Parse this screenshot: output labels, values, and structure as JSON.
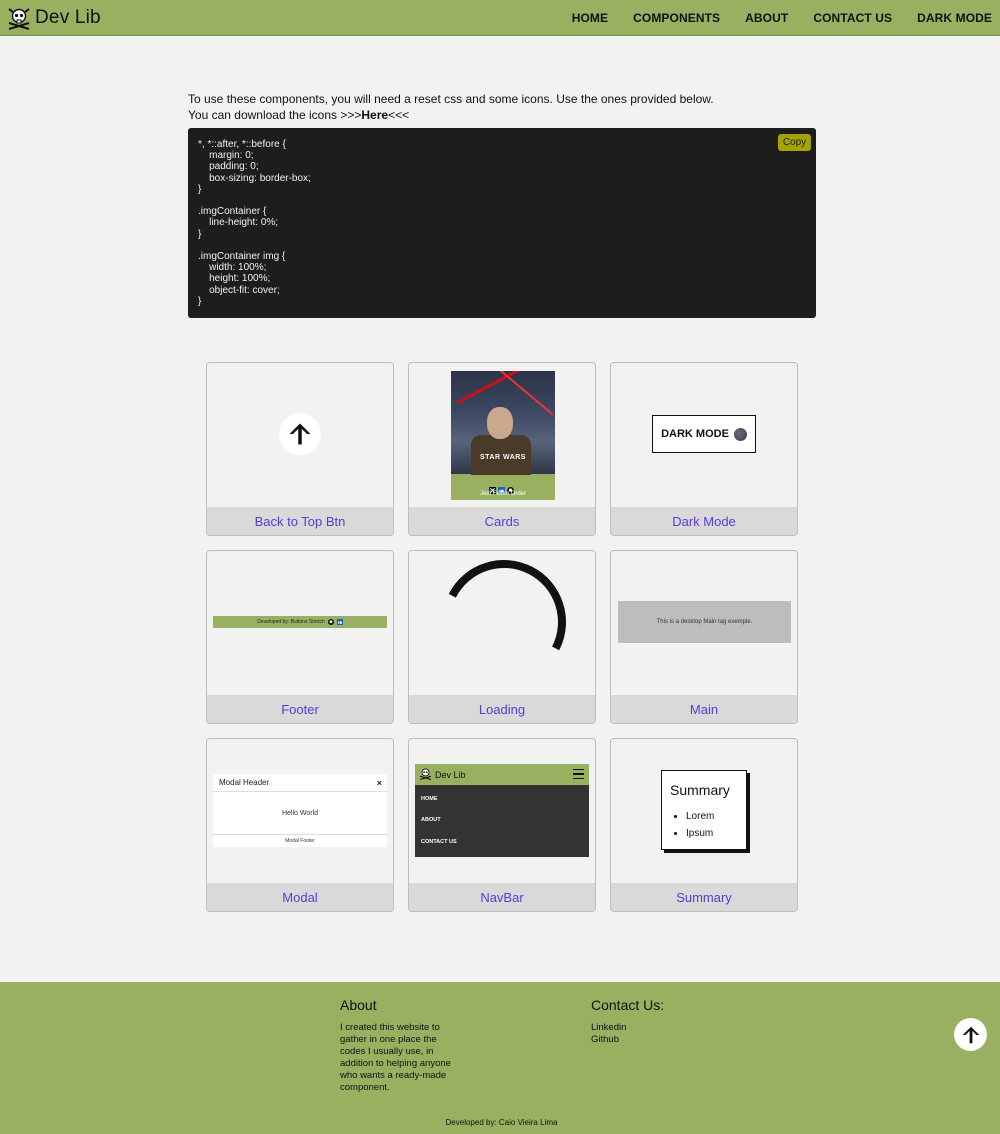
{
  "header": {
    "logo_text": "Dev Lib",
    "logo_icon": "skull-crossbones-icon",
    "nav": [
      "HOME",
      "COMPONENTS",
      "ABOUT",
      "CONTACT US",
      "DARK MODE"
    ]
  },
  "intro": {
    "line1": "To use these components, you will need a reset css and some icons. Use the ones provided below.",
    "line2_prefix": "You can download the icons  >>>",
    "line2_link": "Here",
    "line2_suffix": "<<<"
  },
  "code_block": {
    "copy_label": "Copy",
    "code": "*, *::after, *::before {\n    margin: 0;\n    padding: 0;\n    box-sizing: border-box;\n}\n\n.imgContainer {\n    line-height: 0%;\n}\n\n.imgContainer img {\n    width: 100%;\n    height: 100%;\n    object-fit: cover;\n}"
  },
  "components": {
    "back_to_top": {
      "label": "Back to Top Btn",
      "icon": "arrow-up-icon"
    },
    "cards": {
      "label": "Cards",
      "poster_text": "STAR WARS",
      "poster_title": "Jedi Fallen Order",
      "icons": [
        "x-icon",
        "linkedin-icon",
        "github-icon"
      ]
    },
    "dark_mode": {
      "label": "Dark Mode",
      "button_text": "DARK MODE",
      "icon": "moon-icon"
    },
    "footer": {
      "label": "Footer",
      "text": "Developed by: Buttons Stretch",
      "icons": [
        "github-icon",
        "linkedin-icon"
      ]
    },
    "loading": {
      "label": "Loading"
    },
    "main": {
      "label": "Main",
      "text": "This is a desktop Main tag exemple."
    },
    "modal": {
      "label": "Modal",
      "header": "Modal Header",
      "close": "×",
      "body": "Hello World",
      "footer": "Modal Footer"
    },
    "navbar": {
      "label": "NavBar",
      "title": "Dev Lib",
      "items": [
        "HOME",
        "ABOUT",
        "CONTACT US"
      ],
      "menu_icon": "hamburger-icon"
    },
    "summary": {
      "label": "Summary",
      "title": "Summary",
      "items": [
        "Lorem",
        "Ipsum"
      ]
    }
  },
  "footer": {
    "about_title": "About",
    "about_text": "I created this website to gather in one place the codes I usually use, in addition to helping anyone who wants a ready-made component.",
    "contact_title": "Contact Us:",
    "links": [
      "Linkedin",
      "Github"
    ],
    "credit": "Developed by: Caio Vieira Lima",
    "top_button_icon": "arrow-up-icon"
  },
  "colors": {
    "accent_green": "#98b060",
    "link_purple": "#5b3bd6",
    "code_bg": "#1d1d1d",
    "copy_btn": "#a4a400"
  }
}
